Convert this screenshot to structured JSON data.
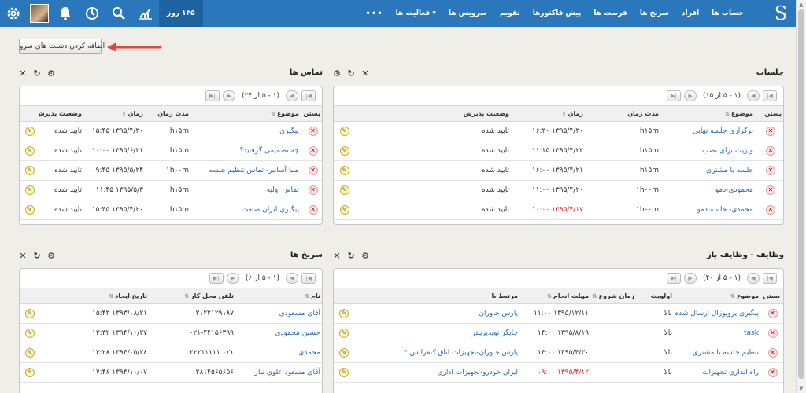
{
  "nav": {
    "brand": "S",
    "items": [
      "حساب ها",
      "افراد",
      "سرنخ ها",
      "فرصت ها",
      "پیش فاکتورها",
      "تقویم",
      "سرویس ها",
      "فعالیت ها ▾",
      "•••"
    ],
    "days": "۱۳۵ روز"
  },
  "add_button": "اضافه کردن دشلت های سرو",
  "panels": {
    "meetings": {
      "title": "جلسات",
      "pager": "(۱ - ۵ از ۱۵)",
      "headers": {
        "close": "بستن",
        "subject": "موضوع",
        "duration": "مدت زمان",
        "time": "زمان",
        "status": "وضعیت پذیرش"
      },
      "rows": [
        {
          "subject": "برگزاری جلسه نهایی",
          "duration": "۰h۱۵m",
          "time": "۱۳۹۵/۴/۳۰ ۱۶:۳۰",
          "status": "تایید شده",
          "time_red": false
        },
        {
          "subject": "ویزیت برای نصب",
          "duration": "۰h۱۵m",
          "time": "۱۳۹۵/۴/۲۲ ۱۱:۱۵",
          "status": "تایید شده",
          "time_red": false
        },
        {
          "subject": "جلسه با مشتری",
          "duration": "۰h۱۵m",
          "time": "۱۳۹۵/۴/۲۱ ۱۶:۰۰",
          "status": "تایید شده",
          "time_red": false
        },
        {
          "subject": "محمودی-دمو",
          "duration": "۱h۰۰m",
          "time": "۱۳۹۵/۴/۲۰ ۱۱:۰۰",
          "status": "تایید شده",
          "time_red": false
        },
        {
          "subject": "محمدی- جلسه دمو",
          "duration": "۱h۰۰m",
          "time": "۱۳۹۵/۴/۱۷ ۱۰:۰۰",
          "status": "تایید شده",
          "time_red": true
        }
      ]
    },
    "calls": {
      "title": "تماس ها",
      "pager": "(۱ - ۵ از ۲۴)",
      "headers": {
        "close": "بستن",
        "subject": "موضوع",
        "duration": "مدت زمان",
        "time": "زمان",
        "status": "وضعیت پذیرش"
      },
      "rows": [
        {
          "subject": "پیگیری",
          "duration": "۰h۱۵m",
          "time": "۱۳۹۵/۴/۳۰ ۱۵:۴۵",
          "status": "تایید شده"
        },
        {
          "subject": "چه تصمیمی گرفتید؟",
          "duration": "۰h۱۵m",
          "time": "۱۳۹۵/۶/۲۱ ۱۰:۰۰",
          "status": "تایید شده"
        },
        {
          "subject": "صبا آسانبر- تماس تنظیم جلسه",
          "duration": "۱h۰۰m",
          "time": "۱۳۹۵/۵/۲۴ ۰۹:۴۵",
          "status": "تایید شده"
        },
        {
          "subject": "تماس اولیه",
          "duration": "۰h۱۵m",
          "time": "۱۳۹۵/۵/۳ ۱۱:۴۵",
          "status": "تایید شده"
        },
        {
          "subject": "پیگیری ایران صنعت",
          "duration": "۰h۱۵m",
          "time": "۱۳۹۵/۴/۲۰ ۱۵:۴۵",
          "status": "تایید شده"
        }
      ]
    },
    "tasks": {
      "title": "وظایف - وظایف باز",
      "pager": "(۱ - ۵ از ۴۰)",
      "headers": {
        "close": "بستن",
        "subject": "موضوع",
        "priority": "اولویت",
        "start": "زمان شروع",
        "due": "مهلت انجام",
        "related": "مرتبط با"
      },
      "rows": [
        {
          "subject": "پیگیری پروپوزال ارسال شده",
          "priority": "بالا",
          "start": "",
          "due": "۱۳۹۵/۱۲/۱۱ ۱۱:۰۰",
          "related": "پارس خاوران",
          "due_red": false
        },
        {
          "subject": "task",
          "priority": "بالا",
          "start": "",
          "due": "۱۳۹۵/۸/۱۹ ۱۴:۰۰",
          "related": "چاپگر نویدپرینتر",
          "due_red": false
        },
        {
          "subject": "تنظیم جلسه با مشتری",
          "priority": "بالا",
          "start": "",
          "due": "۱۳۹۵/۴/۳۰ ۱۴:۰۰",
          "related": "پارس خاوران-تجهیزات اتاق کنفرانس ۲",
          "due_red": false
        },
        {
          "subject": "راه اندازی تجهیزات",
          "priority": "بالا",
          "start": "",
          "due": "۱۳۹۵/۴/۱۲ ۰۹:۰۰",
          "related": "ایران خودرو-تجهیزات اداری",
          "due_red": true
        }
      ]
    },
    "leads": {
      "title": "سرنخ ها",
      "pager": "(۱ - ۵ از ۶)",
      "headers": {
        "name": "نام",
        "phone": "تلفن محل کار",
        "created": "تاریخ ایجاد"
      },
      "rows": [
        {
          "name": "آقای مسعودی",
          "phone": "۰۲۱۲۲۱۲۹۱۸۷",
          "created": "۱۳۹۳/۰۸/۲۱ ۱۵:۴۳"
        },
        {
          "name": "حسین محمودی",
          "phone": "۰۲۱-۴۴۱۵۶۳۹۹",
          "created": "۱۳۹۴/۱۰/۲۷ ۱۲:۳۲"
        },
        {
          "name": "محمدی",
          "phone": "۰۲۱ ۲۲۲۱۱۱۱۱",
          "created": "۱۳۹۴/۰۵/۲۸ ۱۳:۲۸"
        },
        {
          "name": "آقای مسعود علوی تبار",
          "phone": "۰۲۸۱۴۵۶۵۶۵۶",
          "created": "۱۳۹۴/۱۰/۰۷ ۱۷:۴۶"
        }
      ]
    }
  },
  "colors": {
    "topbar": "#2a77bc",
    "link": "#2a67ad",
    "overdue": "#dd2222",
    "background": "#f0eee9"
  }
}
